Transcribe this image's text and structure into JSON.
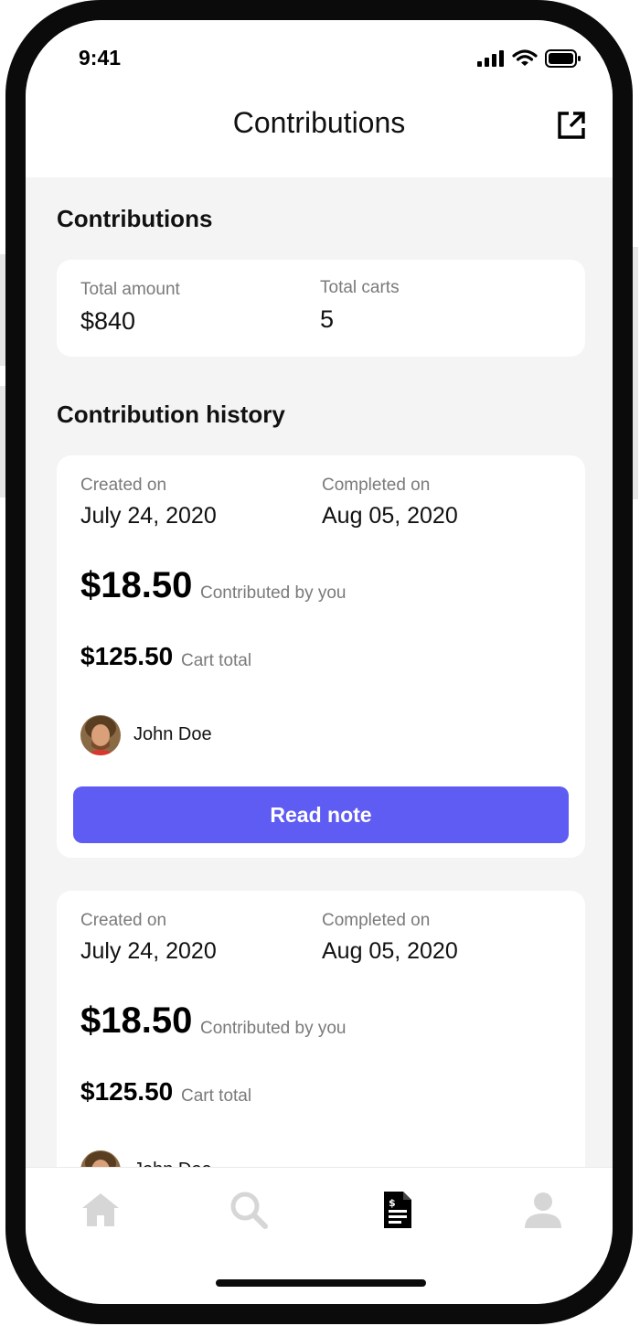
{
  "status_bar": {
    "time": "9:41"
  },
  "header": {
    "title": "Contributions",
    "share_icon": "external-link-icon"
  },
  "summary": {
    "title": "Contributions",
    "total_amount_label": "Total amount",
    "total_amount_value": "$840",
    "total_carts_label": "Total carts",
    "total_carts_value": "5"
  },
  "history": {
    "title": "Contribution history",
    "items": [
      {
        "created_label": "Created on",
        "created_value": "July 24, 2020",
        "completed_label": "Completed on",
        "completed_value": "Aug 05, 2020",
        "contributed_amount": "$18.50",
        "contributed_label": "Contributed by you",
        "cart_total_amount": "$125.50",
        "cart_total_label": "Cart total",
        "contributor_name": "John Doe",
        "button_label": "Read note"
      },
      {
        "created_label": "Created on",
        "created_value": "July 24, 2020",
        "completed_label": "Completed on",
        "completed_value": "Aug 05, 2020",
        "contributed_amount": "$18.50",
        "contributed_label": "Contributed by you",
        "cart_total_amount": "$125.50",
        "cart_total_label": "Cart total",
        "contributor_name": "John Doe"
      }
    ]
  },
  "tab_bar": {
    "items": [
      {
        "icon": "home-icon",
        "active": false
      },
      {
        "icon": "search-icon",
        "active": false
      },
      {
        "icon": "receipt-icon",
        "active": true
      },
      {
        "icon": "profile-icon",
        "active": false
      }
    ]
  },
  "colors": {
    "accent": "#5f5cf3",
    "background": "#f4f4f4",
    "inactive_icon": "#d6d6d6"
  }
}
